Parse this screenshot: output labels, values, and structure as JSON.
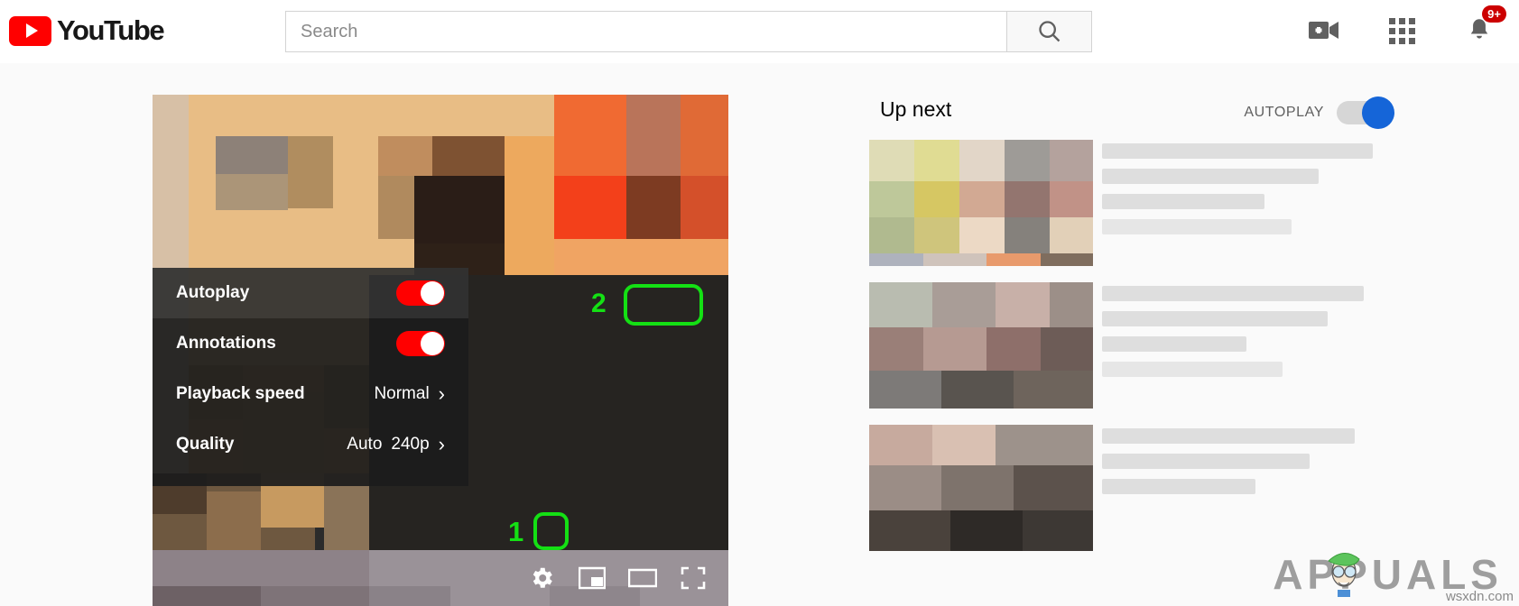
{
  "header": {
    "brand": "YouTube",
    "logo_icon": "youtube-play-icon",
    "search": {
      "placeholder": "Search",
      "value": "",
      "button_icon": "search-icon"
    },
    "icons": [
      {
        "name": "create-video-icon",
        "label": "Create"
      },
      {
        "name": "apps-grid-icon",
        "label": "YouTube apps"
      },
      {
        "name": "notifications-bell-icon",
        "label": "Notifications",
        "badge": "9+"
      }
    ]
  },
  "player": {
    "settings_menu": {
      "rows": [
        {
          "label": "Autoplay",
          "type": "toggle",
          "state": "on",
          "highlighted": true
        },
        {
          "label": "Annotations",
          "type": "toggle",
          "state": "on",
          "highlighted": false
        },
        {
          "label": "Playback speed",
          "type": "submenu",
          "value": "Normal",
          "value_sub": "",
          "chevron": "›"
        },
        {
          "label": "Quality",
          "type": "submenu",
          "value": "Auto",
          "value_sub": "240p",
          "chevron": "›"
        }
      ]
    },
    "controls": [
      {
        "name": "settings-gear-icon",
        "label": "Settings",
        "highlighted": true
      },
      {
        "name": "miniplayer-icon",
        "label": "Miniplayer",
        "highlighted": false
      },
      {
        "name": "theater-mode-icon",
        "label": "Theater mode",
        "highlighted": false
      },
      {
        "name": "fullscreen-icon",
        "label": "Full screen",
        "highlighted": false
      }
    ],
    "annotations": [
      {
        "step": "1",
        "target": "settings-gear-icon"
      },
      {
        "step": "2",
        "target": "autoplay-toggle"
      }
    ],
    "highlight_color": "#14e014",
    "toggle_on_color": "#ff0000"
  },
  "sidebar": {
    "title": "Up next",
    "autoplay_label": "AUTOPLAY",
    "autoplay_state": "on",
    "autoplay_color": "#1565d8",
    "items": [
      {
        "name": "suggested-video-1"
      },
      {
        "name": "suggested-video-2"
      },
      {
        "name": "suggested-video-3"
      }
    ]
  },
  "watermark": {
    "brand": "APPUALS",
    "site": "wsxdn.com",
    "mascot_icon": "appuals-mascot-icon"
  }
}
